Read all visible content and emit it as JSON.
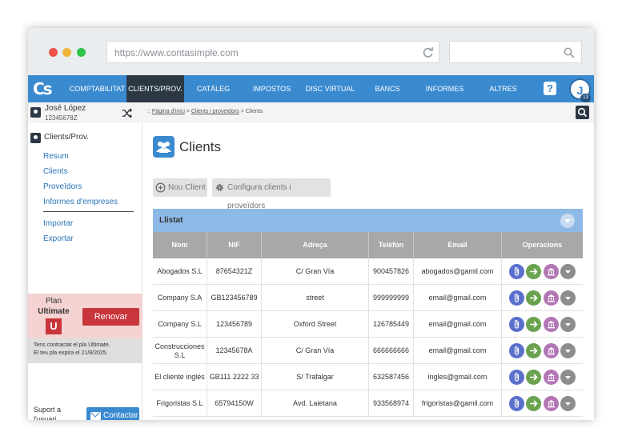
{
  "browser": {
    "url": "https://www.contasimple.com"
  },
  "app": {
    "logo": "Cs",
    "nav": [
      {
        "label": "COMPTABILITAT",
        "active": false
      },
      {
        "label": "CLIENTS/PROV.",
        "active": true
      },
      {
        "label": "CATÀLEG",
        "active": false
      },
      {
        "label": "IMPOSTOS",
        "active": false
      },
      {
        "label": "DISC VIRTUAL",
        "active": false
      },
      {
        "label": "BANCS",
        "active": false
      },
      {
        "label": "INFORMES",
        "active": false
      },
      {
        "label": "ALTRES",
        "active": false
      }
    ],
    "help_icon": "?",
    "avatar_initial": "J",
    "avatar_badge": "13",
    "accent_color": "#3a8ad0"
  },
  "sidebar": {
    "user_name": "José López",
    "user_nif": "12345678Z",
    "section_title": "Clients/Prov.",
    "links_top": [
      "Resum",
      "Clients",
      "Proveïdors",
      "Informes d'empreses"
    ],
    "links_bottom": [
      "Importar",
      "Exportar"
    ],
    "plan": {
      "label": "Plan",
      "name": "Ultimate",
      "icon_letter": "U",
      "renew_label": "Renovar",
      "note_line1": "Tens contractat el pla Ultimate.",
      "note_line2": "El teu pla expira el 21/8/2025."
    },
    "support_text": "Suport a l'usuari",
    "contact_label": "Contactar"
  },
  "breadcrumb": {
    "prefix": "::",
    "items": [
      "Pàgina d'inici",
      "Clients i proveïdors",
      "Clients"
    ],
    "separator": ">"
  },
  "main": {
    "title": "Clients",
    "new_client_label": "Nou Client",
    "configure_label": "Configura clients i proveïdors",
    "list_title": "Llistat",
    "columns": [
      "Nom",
      "NIF",
      "Adreça",
      "Telèfon",
      "Email",
      "Operacions"
    ],
    "rows": [
      {
        "name": "Abogados S.L",
        "nif": "87654321Z",
        "address": "C/ Gran Vía",
        "phone": "900457826",
        "email": "abogados@gamil.com"
      },
      {
        "name": "Company S.A",
        "nif": "GB123456789",
        "address": "street",
        "phone": "999999999",
        "email": "email@gmail.com"
      },
      {
        "name": "Company S.L",
        "nif": "123456789",
        "address": "Oxford Street",
        "phone": "126785449",
        "email": "email@gmail.com"
      },
      {
        "name": "Construcciones S.L",
        "nif": "12345678A",
        "address": "C/ Gran Vía",
        "phone": "666666666",
        "email": "email@gmail.com"
      },
      {
        "name": "El cliente inglés",
        "nif": "GB111 2222 33",
        "address": "S/ Trafalgar",
        "phone": "632587456",
        "email": "ingles@gmail.com"
      },
      {
        "name": "Frigoristas S.L",
        "nif": "65794150W",
        "address": "Avd. Laietana",
        "phone": "933568974",
        "email": "frigoristas@gamil.com"
      }
    ]
  }
}
